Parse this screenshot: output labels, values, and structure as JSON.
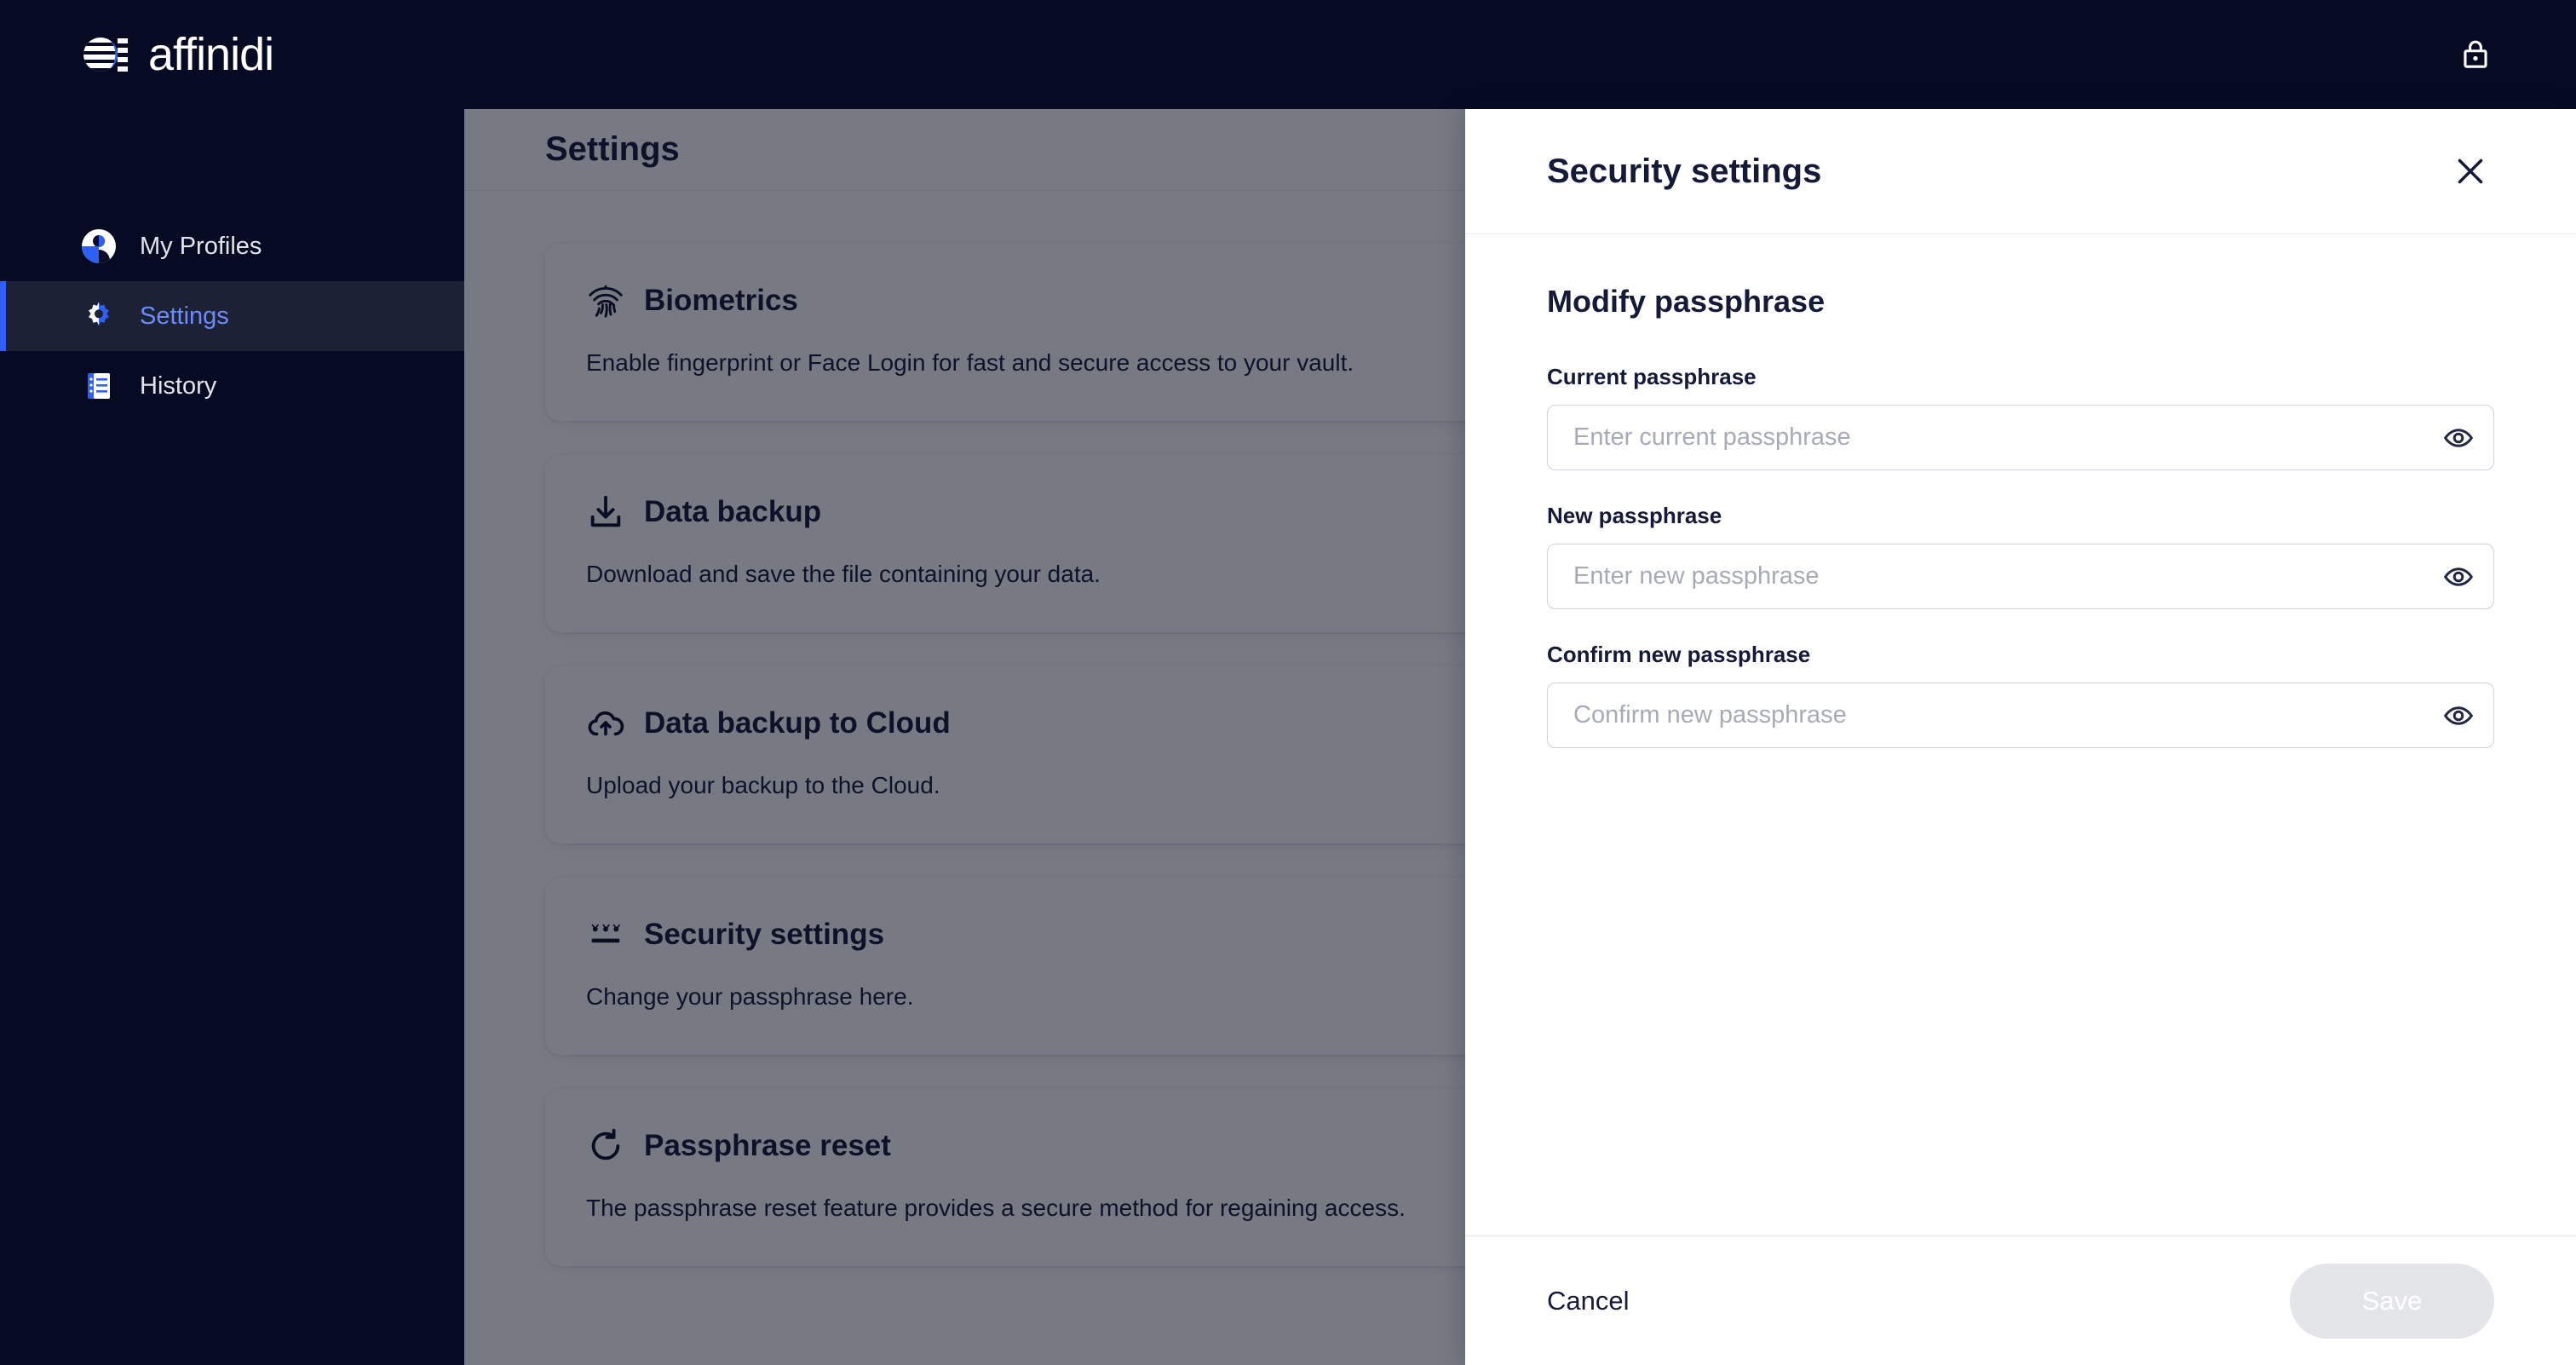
{
  "app": {
    "brand_name": "affinidi",
    "brand_mark_icon": "affinidi-logo-icon",
    "lock_icon": "lock-icon"
  },
  "sidebar": {
    "items": [
      {
        "label": "My Profiles",
        "icon": "user-avatar-icon",
        "active": false
      },
      {
        "label": "Settings",
        "icon": "gear-icon",
        "active": true
      },
      {
        "label": "History",
        "icon": "history-list-icon",
        "active": false
      }
    ]
  },
  "main": {
    "page_title": "Settings",
    "cards": [
      {
        "title": "Biometrics",
        "icon": "fingerprint-icon",
        "description": "Enable fingerprint or Face Login for fast and secure access to your vault."
      },
      {
        "title": "Data backup",
        "icon": "download-icon",
        "description": "Download and save the file containing your data."
      },
      {
        "title": "Data backup to Cloud",
        "icon": "cloud-upload-icon",
        "description": "Upload your backup to the Cloud."
      },
      {
        "title": "Security settings",
        "icon": "password-dots-icon",
        "description": "Change your passphrase here."
      },
      {
        "title": "Passphrase reset",
        "icon": "refresh-icon",
        "description": "The passphrase reset feature provides a secure method for regaining access."
      }
    ]
  },
  "drawer": {
    "title": "Security settings",
    "close_icon": "close-icon",
    "section_title": "Modify passphrase",
    "fields": [
      {
        "label": "Current passphrase",
        "placeholder": "Enter current passphrase",
        "value": "",
        "toggle_icon": "eye-icon"
      },
      {
        "label": "New passphrase",
        "placeholder": "Enter new passphrase",
        "value": "",
        "toggle_icon": "eye-icon"
      },
      {
        "label": "Confirm new passphrase",
        "placeholder": "Confirm new passphrase",
        "value": "",
        "toggle_icon": "eye-icon"
      }
    ],
    "cancel_label": "Cancel",
    "save_label": "Save"
  },
  "colors": {
    "brand_dark": "#070A23",
    "accent_blue": "#2F5FF4",
    "active_nav_text": "#6E8CF7",
    "text_dark": "#151A38",
    "save_disabled_bg": "#E4E5E9"
  }
}
